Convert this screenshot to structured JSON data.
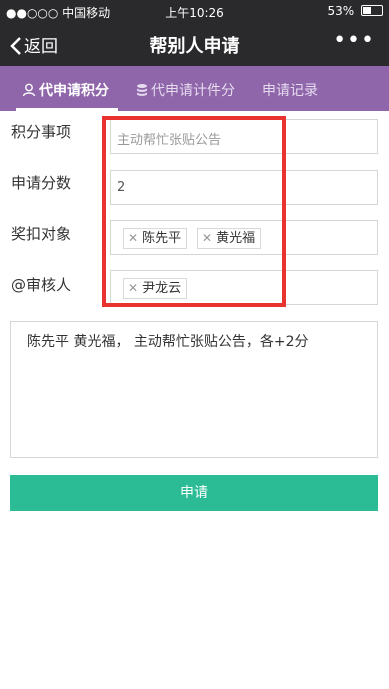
{
  "status_bar": {
    "carrier": "●●○○○ 中国移动",
    "time": "上午10:26",
    "battery_text": "53%",
    "battery_level": 0.53
  },
  "nav": {
    "back_label": "返回",
    "title": "帮别人申请",
    "more_label": "•••"
  },
  "tabs": [
    {
      "label": "代申请积分",
      "icon": "user-icon",
      "active": true
    },
    {
      "label": "代申请计件分",
      "icon": "database-icon",
      "active": false
    },
    {
      "label": "申请记录",
      "active": false
    }
  ],
  "form": {
    "item_label": "积分事项",
    "item_placeholder": "主动帮忙张贴公告",
    "score_label": "申请分数",
    "score_value": "2",
    "target_label": "奖扣对象",
    "targets": [
      "陈先平",
      "黄光福"
    ],
    "reviewer_label": "@审核人",
    "reviewers": [
      "尹龙云"
    ],
    "description": "陈先平 黄光福， 主动帮忙张贴公告，各+2分",
    "submit_label": "申请"
  },
  "colors": {
    "tab_bar": "#8f66aa",
    "submit": "#2bbc95",
    "highlight_box": "#e8332f",
    "nav_bar": "#2a2a2c"
  }
}
